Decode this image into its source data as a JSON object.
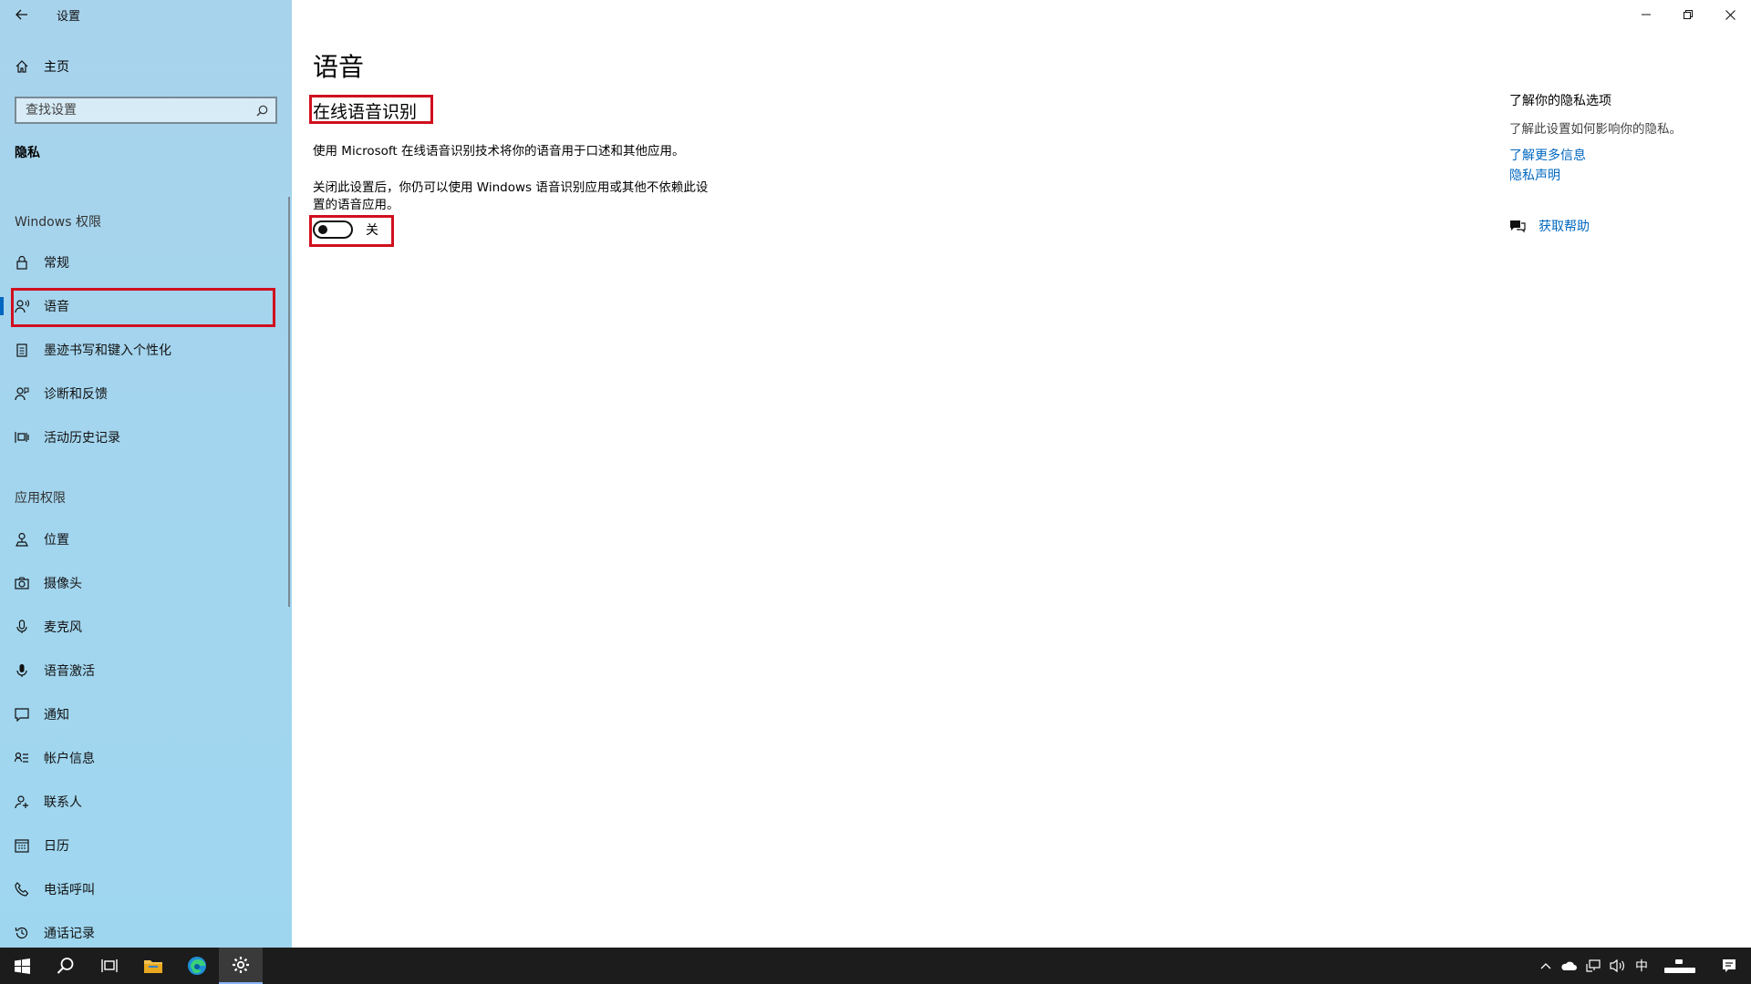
{
  "window": {
    "app_title": "设置",
    "controls": [
      "minimize",
      "restore",
      "close"
    ]
  },
  "sidebar": {
    "home_label": "主页",
    "search_placeholder": "查找设置",
    "section_title": "隐私",
    "groups": [
      {
        "label": "Windows 权限",
        "items": [
          {
            "label": "常规",
            "icon": "lock-icon"
          },
          {
            "label": "语音",
            "icon": "speech-icon",
            "selected": true
          },
          {
            "label": "墨迹书写和键入个性化",
            "icon": "clipboard-icon"
          },
          {
            "label": "诊断和反馈",
            "icon": "feedback-icon"
          },
          {
            "label": "活动历史记录",
            "icon": "timeline-icon"
          }
        ]
      },
      {
        "label": "应用权限",
        "items": [
          {
            "label": "位置",
            "icon": "location-icon"
          },
          {
            "label": "摄像头",
            "icon": "camera-icon"
          },
          {
            "label": "麦克风",
            "icon": "microphone-icon"
          },
          {
            "label": "语音激活",
            "icon": "voice-activation-icon"
          },
          {
            "label": "通知",
            "icon": "notification-icon"
          },
          {
            "label": "帐户信息",
            "icon": "account-info-icon"
          },
          {
            "label": "联系人",
            "icon": "contacts-icon"
          },
          {
            "label": "日历",
            "icon": "calendar-icon"
          },
          {
            "label": "电话呼叫",
            "icon": "phone-icon"
          },
          {
            "label": "通话记录",
            "icon": "call-history-icon"
          }
        ]
      }
    ]
  },
  "main": {
    "page_title": "语音",
    "section_title": "在线语音识别",
    "description_1": "使用 Microsoft 在线语音识别技术将你的语音用于口述和其他应用。",
    "description_2": "关闭此设置后，你仍可以使用 Windows 语音识别应用或其他不依赖此设置的语音应用。",
    "toggle": {
      "state": "off",
      "label": "关"
    }
  },
  "right_panel": {
    "title": "了解你的隐私选项",
    "description": "了解此设置如何影响你的隐私。",
    "links": [
      "了解更多信息",
      "隐私声明"
    ],
    "help_label": "获取帮助"
  },
  "taskbar": {
    "apps": [
      "start-icon",
      "search-icon",
      "task-view-icon",
      "file-explorer-icon",
      "edge-icon",
      "settings-icon"
    ],
    "active_app": "settings-icon",
    "ime_label": "中"
  },
  "colors": {
    "accent": "#0067c0",
    "highlight": "#d0101e",
    "taskbar": "#1c1c1c"
  }
}
